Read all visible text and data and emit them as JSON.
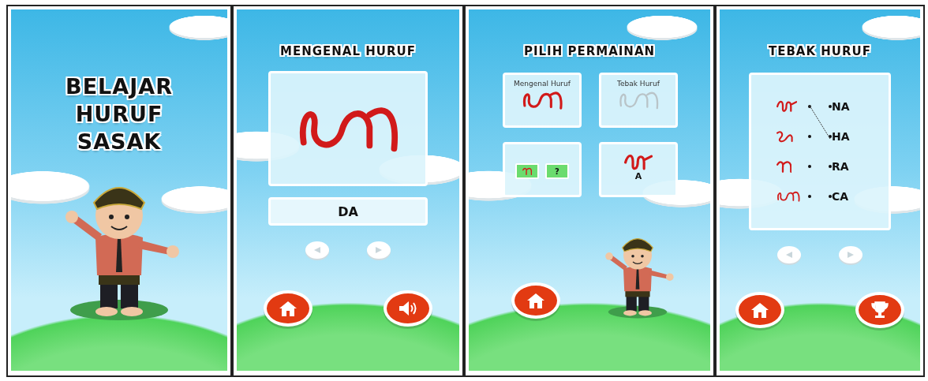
{
  "screens": [
    {
      "kind": "title",
      "title_lines": [
        "BELAJAR",
        "HURUF",
        "SASAK"
      ]
    },
    {
      "kind": "learn",
      "title": "MENGENAL HURUF",
      "letter": "DA",
      "buttons": [
        {
          "kind": "home"
        },
        {
          "kind": "sound"
        }
      ]
    },
    {
      "kind": "menu",
      "title": "PILIH PERMAINAN",
      "cards": [
        {
          "kind": "learn",
          "label": "Mengenal Huruf"
        },
        {
          "kind": "guess",
          "label": "Tebak Huruf"
        },
        {
          "kind": "pair",
          "tile": "?"
        },
        {
          "kind": "cycle",
          "letter": "A"
        }
      ],
      "buttons": [
        {
          "kind": "home"
        }
      ]
    },
    {
      "kind": "quiz",
      "title": "TEBAK HURUF",
      "answers": [
        "NA",
        "HA",
        "RA",
        "CA"
      ],
      "buttons": [
        {
          "kind": "home"
        },
        {
          "kind": "trophy"
        }
      ]
    }
  ]
}
